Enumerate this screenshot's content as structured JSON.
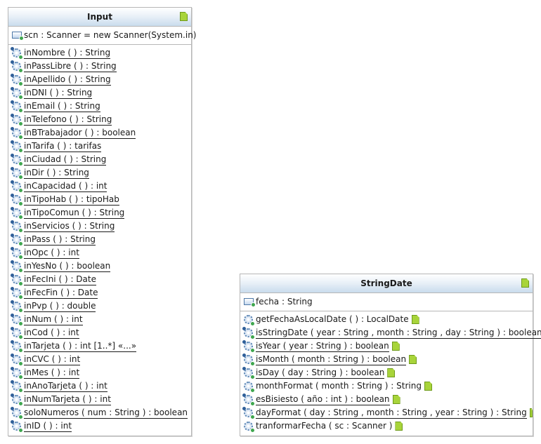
{
  "diagram": {
    "classes": [
      {
        "id": "input",
        "name": "Input",
        "fields": [
          {
            "text": "scn : Scanner = new Scanner(System.in)",
            "underline": false
          }
        ],
        "methods": [
          {
            "text": "inNombre ( ) : String"
          },
          {
            "text": "inPassLibre ( ) : String"
          },
          {
            "text": "inApellido ( ) : String"
          },
          {
            "text": "inDNI ( ) : String"
          },
          {
            "text": "inEmail ( ) : String"
          },
          {
            "text": "inTelefono ( ) : String"
          },
          {
            "text": "inBTrabajador ( ) : boolean"
          },
          {
            "text": "inTarifa ( ) : tarifas"
          },
          {
            "text": "inCiudad ( ) : String"
          },
          {
            "text": "inDir ( ) : String"
          },
          {
            "text": "inCapacidad ( ) : int"
          },
          {
            "text": "inTipoHab ( ) : tipoHab"
          },
          {
            "text": "inTipoComun ( ) : String"
          },
          {
            "text": "inServicios ( ) : String"
          },
          {
            "text": "inPass ( ) : String"
          },
          {
            "text": "inOpc ( ) : int"
          },
          {
            "text": "inYesNo ( ) : boolean"
          },
          {
            "text": "inFecIni ( ) : Date"
          },
          {
            "text": "inFecFin ( ) : Date"
          },
          {
            "text": "inPvp ( ) : double"
          },
          {
            "text": "inNum ( ) : int"
          },
          {
            "text": "inCod ( ) : int"
          },
          {
            "text": "inTarjeta ( ) : int [1..*] «...»"
          },
          {
            "text": "inCVC ( ) : int"
          },
          {
            "text": "inMes ( ) : int"
          },
          {
            "text": "inAnoTarjeta ( ) : int"
          },
          {
            "text": "inNumTarjeta ( ) : int"
          },
          {
            "text": "soloNumeros ( num : String ) : boolean"
          },
          {
            "text": "inID ( ) : int"
          }
        ]
      },
      {
        "id": "stringdate",
        "name": "StringDate",
        "fields": [
          {
            "text": "fecha : String",
            "underline": false
          }
        ],
        "methods": [
          {
            "text": "getFechaAsLocalDate ( ) : LocalDate",
            "underline": false
          },
          {
            "text": "isStringDate ( year : String , month : String , day : String ) : boolean",
            "underline": true
          },
          {
            "text": "isYear ( year : String ) : boolean",
            "underline": true
          },
          {
            "text": "isMonth ( month : String ) : boolean",
            "underline": true
          },
          {
            "text": "isDay ( day : String ) : boolean",
            "underline": true
          },
          {
            "text": "monthFormat ( month : String ) : String",
            "underline": false
          },
          {
            "text": "esBisiesto ( año : int ) : boolean",
            "underline": true
          },
          {
            "text": "dayFormat ( day : String , month : String , year : String ) : String",
            "underline": true
          },
          {
            "text": "tranformarFecha ( sc : Scanner )",
            "underline": false
          }
        ]
      }
    ]
  },
  "icons": {
    "class_file": "java-file-icon",
    "field": "field-icon",
    "method": "method-icon"
  },
  "colors": {
    "header_gradient_bottom": "#c9dced",
    "border": "#b7b7b7",
    "file_icon": "#a8d43a",
    "visibility_dot": "#3fa64f"
  }
}
